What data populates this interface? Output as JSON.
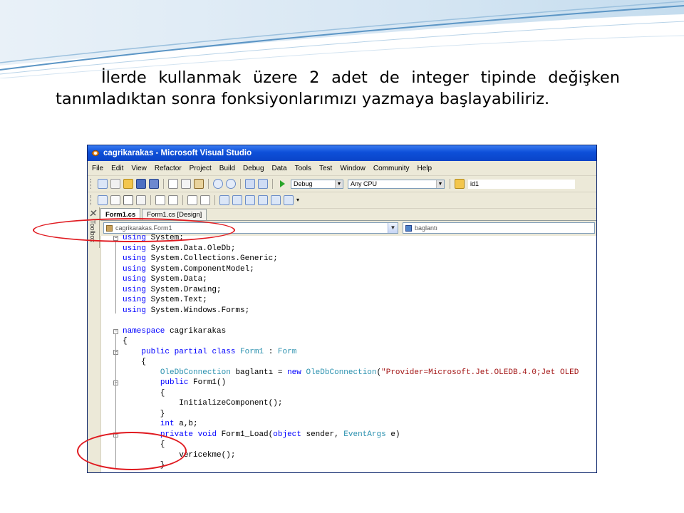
{
  "caption": {
    "line1": "İlerde kullanmak üzere 2 adet de integer tipinde değişken",
    "line2": "tanımladıktan sonra fonksiyonlarımızı yazmaya başlayabiliriz."
  },
  "window": {
    "title": "cagrikarakas - Microsoft Visual Studio"
  },
  "menu": [
    "File",
    "Edit",
    "View",
    "Refactor",
    "Project",
    "Build",
    "Debug",
    "Data",
    "Tools",
    "Test",
    "Window",
    "Community",
    "Help"
  ],
  "toolbar": {
    "config": "Debug",
    "platform": "Any CPU",
    "find_value": "id1"
  },
  "toolbox_label": "Toolbox",
  "tabs": [
    {
      "label": "Form1.cs",
      "active": true
    },
    {
      "label": "Form1.cs [Design]",
      "active": false
    }
  ],
  "navbar": {
    "class_combo": "cagrikarakas.Form1",
    "member_combo": "baglantı"
  },
  "code_lines": [
    "using System;",
    "using System.Data.OleDb;",
    "using System.Collections.Generic;",
    "using System.ComponentModel;",
    "using System.Data;",
    "using System.Drawing;",
    "using System.Text;",
    "using System.Windows.Forms;",
    "",
    "namespace cagrikarakas",
    "{",
    "    public partial class Form1 : Form",
    "    {",
    "        OleDbConnection baglantı = new OleDbConnection(\"Provider=Microsoft.Jet.OLEDB.4.0;Jet OLED",
    "        public Form1()",
    "        {",
    "            InitializeComponent();",
    "        }",
    "        int a,b;",
    "        private void Form1_Load(object sender, EventArgs e)",
    "        {",
    "            vericekme();",
    "        }"
  ],
  "colors": {
    "keyword": "#0000ff",
    "type": "#2b91af",
    "string": "#a31515",
    "annotation": "#e0191f",
    "title_bar": "#0d4fd8"
  }
}
